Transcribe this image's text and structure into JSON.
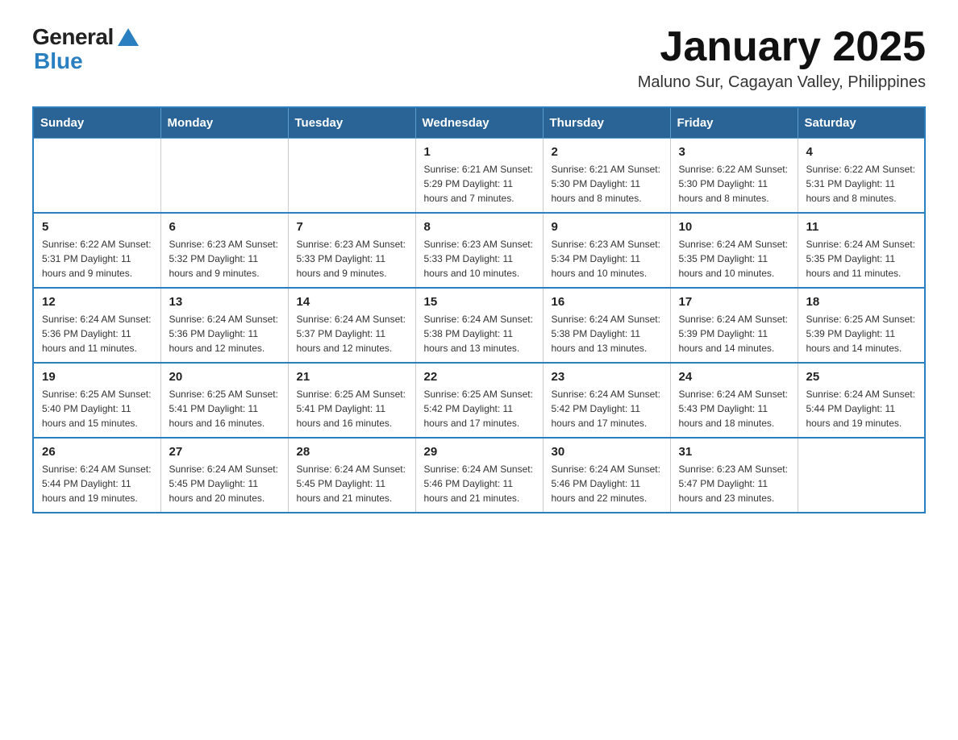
{
  "header": {
    "logo_general": "General",
    "logo_blue": "Blue",
    "main_title": "January 2025",
    "subtitle": "Maluno Sur, Cagayan Valley, Philippines"
  },
  "days_of_week": [
    "Sunday",
    "Monday",
    "Tuesday",
    "Wednesday",
    "Thursday",
    "Friday",
    "Saturday"
  ],
  "weeks": [
    [
      {
        "day": "",
        "info": ""
      },
      {
        "day": "",
        "info": ""
      },
      {
        "day": "",
        "info": ""
      },
      {
        "day": "1",
        "info": "Sunrise: 6:21 AM\nSunset: 5:29 PM\nDaylight: 11 hours and 7 minutes."
      },
      {
        "day": "2",
        "info": "Sunrise: 6:21 AM\nSunset: 5:30 PM\nDaylight: 11 hours and 8 minutes."
      },
      {
        "day": "3",
        "info": "Sunrise: 6:22 AM\nSunset: 5:30 PM\nDaylight: 11 hours and 8 minutes."
      },
      {
        "day": "4",
        "info": "Sunrise: 6:22 AM\nSunset: 5:31 PM\nDaylight: 11 hours and 8 minutes."
      }
    ],
    [
      {
        "day": "5",
        "info": "Sunrise: 6:22 AM\nSunset: 5:31 PM\nDaylight: 11 hours and 9 minutes."
      },
      {
        "day": "6",
        "info": "Sunrise: 6:23 AM\nSunset: 5:32 PM\nDaylight: 11 hours and 9 minutes."
      },
      {
        "day": "7",
        "info": "Sunrise: 6:23 AM\nSunset: 5:33 PM\nDaylight: 11 hours and 9 minutes."
      },
      {
        "day": "8",
        "info": "Sunrise: 6:23 AM\nSunset: 5:33 PM\nDaylight: 11 hours and 10 minutes."
      },
      {
        "day": "9",
        "info": "Sunrise: 6:23 AM\nSunset: 5:34 PM\nDaylight: 11 hours and 10 minutes."
      },
      {
        "day": "10",
        "info": "Sunrise: 6:24 AM\nSunset: 5:35 PM\nDaylight: 11 hours and 10 minutes."
      },
      {
        "day": "11",
        "info": "Sunrise: 6:24 AM\nSunset: 5:35 PM\nDaylight: 11 hours and 11 minutes."
      }
    ],
    [
      {
        "day": "12",
        "info": "Sunrise: 6:24 AM\nSunset: 5:36 PM\nDaylight: 11 hours and 11 minutes."
      },
      {
        "day": "13",
        "info": "Sunrise: 6:24 AM\nSunset: 5:36 PM\nDaylight: 11 hours and 12 minutes."
      },
      {
        "day": "14",
        "info": "Sunrise: 6:24 AM\nSunset: 5:37 PM\nDaylight: 11 hours and 12 minutes."
      },
      {
        "day": "15",
        "info": "Sunrise: 6:24 AM\nSunset: 5:38 PM\nDaylight: 11 hours and 13 minutes."
      },
      {
        "day": "16",
        "info": "Sunrise: 6:24 AM\nSunset: 5:38 PM\nDaylight: 11 hours and 13 minutes."
      },
      {
        "day": "17",
        "info": "Sunrise: 6:24 AM\nSunset: 5:39 PM\nDaylight: 11 hours and 14 minutes."
      },
      {
        "day": "18",
        "info": "Sunrise: 6:25 AM\nSunset: 5:39 PM\nDaylight: 11 hours and 14 minutes."
      }
    ],
    [
      {
        "day": "19",
        "info": "Sunrise: 6:25 AM\nSunset: 5:40 PM\nDaylight: 11 hours and 15 minutes."
      },
      {
        "day": "20",
        "info": "Sunrise: 6:25 AM\nSunset: 5:41 PM\nDaylight: 11 hours and 16 minutes."
      },
      {
        "day": "21",
        "info": "Sunrise: 6:25 AM\nSunset: 5:41 PM\nDaylight: 11 hours and 16 minutes."
      },
      {
        "day": "22",
        "info": "Sunrise: 6:25 AM\nSunset: 5:42 PM\nDaylight: 11 hours and 17 minutes."
      },
      {
        "day": "23",
        "info": "Sunrise: 6:24 AM\nSunset: 5:42 PM\nDaylight: 11 hours and 17 minutes."
      },
      {
        "day": "24",
        "info": "Sunrise: 6:24 AM\nSunset: 5:43 PM\nDaylight: 11 hours and 18 minutes."
      },
      {
        "day": "25",
        "info": "Sunrise: 6:24 AM\nSunset: 5:44 PM\nDaylight: 11 hours and 19 minutes."
      }
    ],
    [
      {
        "day": "26",
        "info": "Sunrise: 6:24 AM\nSunset: 5:44 PM\nDaylight: 11 hours and 19 minutes."
      },
      {
        "day": "27",
        "info": "Sunrise: 6:24 AM\nSunset: 5:45 PM\nDaylight: 11 hours and 20 minutes."
      },
      {
        "day": "28",
        "info": "Sunrise: 6:24 AM\nSunset: 5:45 PM\nDaylight: 11 hours and 21 minutes."
      },
      {
        "day": "29",
        "info": "Sunrise: 6:24 AM\nSunset: 5:46 PM\nDaylight: 11 hours and 21 minutes."
      },
      {
        "day": "30",
        "info": "Sunrise: 6:24 AM\nSunset: 5:46 PM\nDaylight: 11 hours and 22 minutes."
      },
      {
        "day": "31",
        "info": "Sunrise: 6:23 AM\nSunset: 5:47 PM\nDaylight: 11 hours and 23 minutes."
      },
      {
        "day": "",
        "info": ""
      }
    ]
  ]
}
